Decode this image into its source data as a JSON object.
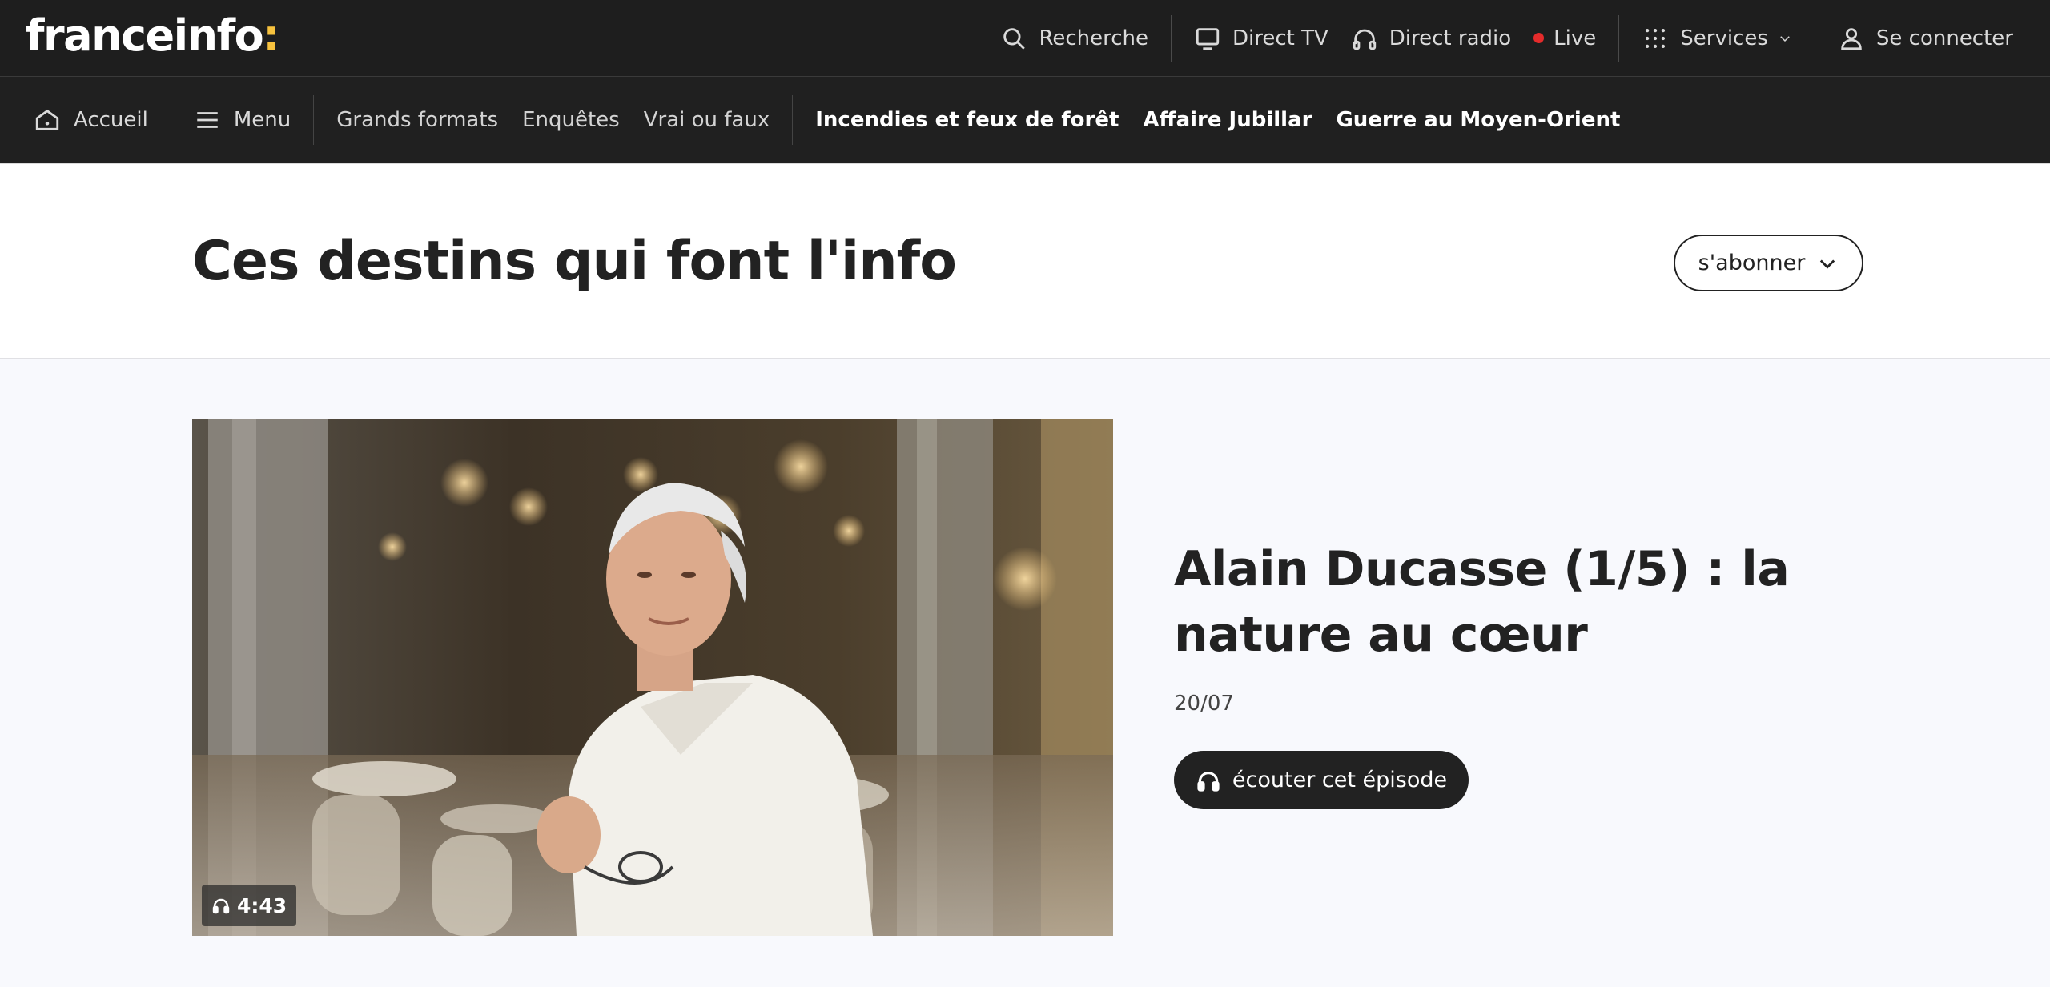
{
  "brand": {
    "logo_text": "franceinfo",
    "logo_colon": ":",
    "accent_color": "#f7c23e"
  },
  "topbar": {
    "search_label": "Recherche",
    "direct_tv_label": "Direct TV",
    "direct_radio_label": "Direct radio",
    "live_label": "Live",
    "live_color": "#e52b2b",
    "services_label": "Services",
    "login_label": "Se connecter"
  },
  "navbar": {
    "home_label": "Accueil",
    "menu_label": "Menu",
    "links": [
      "Grands formats",
      "Enquêtes",
      "Vrai ou faux"
    ],
    "highlights": [
      "Incendies et feux de forêt",
      "Affaire Jubillar",
      "Guerre au Moyen-Orient"
    ]
  },
  "header": {
    "title": "Ces destins qui font l'info",
    "subscribe_label": "s'abonner"
  },
  "episode": {
    "title": "Alain Ducasse (1/5) : la nature au cœur",
    "date": "20/07",
    "duration": "4:43",
    "listen_label": "écouter cet épisode"
  },
  "icons": {
    "search": "search-icon",
    "tv": "tv-icon",
    "headphones": "headphones-icon",
    "grid": "grid-icon",
    "user": "user-icon",
    "home": "home-icon",
    "menu": "hamburger-icon",
    "chevron": "chevron-down-icon"
  }
}
